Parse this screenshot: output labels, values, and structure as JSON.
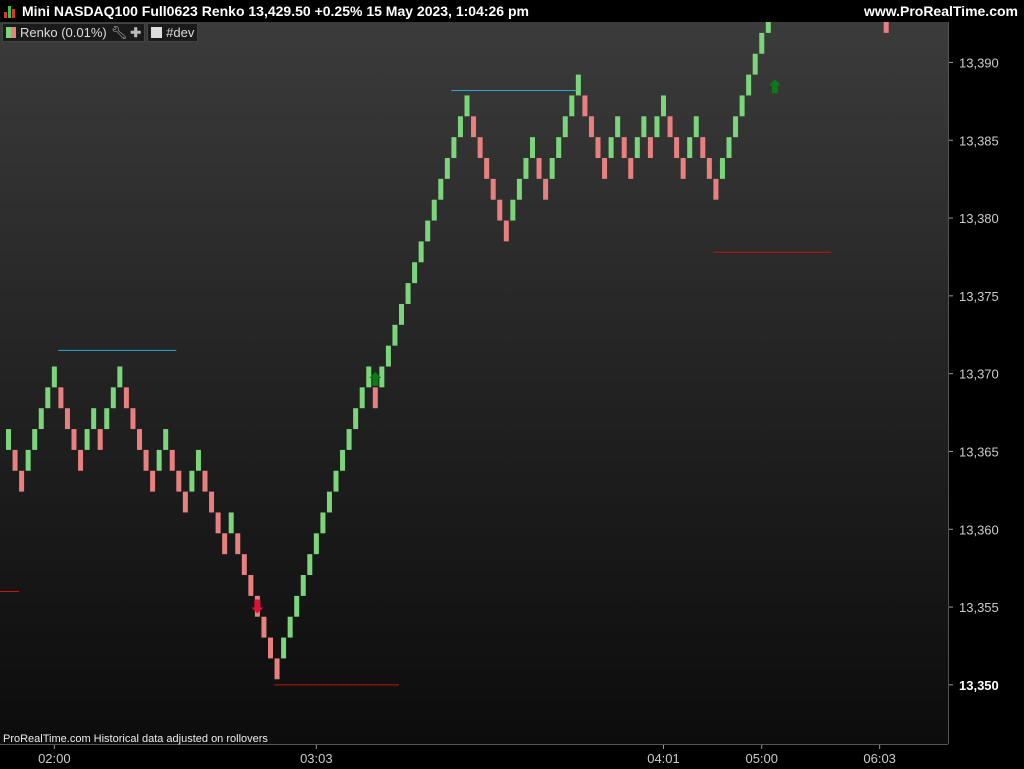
{
  "header": {
    "title": "Mini NASDAQ100 Full0623 Renko 13,429.50 +0.25% 15 May 2023, 1:04:26 pm",
    "site": "www.ProRealTime.com"
  },
  "legend": {
    "indicator_label": "Renko (0.01%)",
    "wrench_icon": "wrench-icon",
    "plus_icon": "plus-icon",
    "dev_label": "#dev",
    "up_color": "#7bd67b",
    "down_color": "#e88080"
  },
  "footer": {
    "note": "ProRealTime.com Historical data adjusted on rollovers"
  },
  "chart_data": {
    "type": "renko",
    "brick_size": 1.34,
    "ylim": [
      13346.2,
      13392.6
    ],
    "y_ticks": [
      13390,
      13385,
      13380,
      13375,
      13370,
      13365,
      13360,
      13355,
      13350
    ],
    "y_tick_labels": [
      "13,390",
      "13,385",
      "13,380",
      "13,375",
      "13,370",
      "13,365",
      "13,360",
      "13,355",
      "13,350"
    ],
    "highlighted_tick": "13,350",
    "x_ticks": [
      {
        "label": "02:00",
        "index": 7
      },
      {
        "label": "03:03",
        "index": 47
      },
      {
        "label": "04:01",
        "index": 100
      },
      {
        "label": "05:00",
        "index": 115
      },
      {
        "label": "06:03",
        "index": 133
      }
    ],
    "start_low": 13365.1,
    "bricks": [
      1,
      -1,
      -1,
      1,
      1,
      1,
      1,
      1,
      -1,
      -1,
      -1,
      -1,
      1,
      1,
      -1,
      1,
      1,
      1,
      -1,
      -1,
      -1,
      -1,
      -1,
      1,
      1,
      -1,
      -1,
      -1,
      1,
      1,
      -1,
      -1,
      -1,
      -1,
      1,
      -1,
      -1,
      -1,
      -1,
      -1,
      -1,
      -1,
      1,
      1,
      1,
      1,
      1,
      1,
      1,
      1,
      1,
      1,
      1,
      1,
      1,
      1,
      -1,
      1,
      1,
      1,
      1,
      1,
      1,
      1,
      1,
      1,
      1,
      1,
      1,
      1,
      1,
      -1,
      -1,
      -1,
      -1,
      -1,
      -1,
      1,
      1,
      1,
      1,
      -1,
      -1,
      1,
      1,
      1,
      1,
      1,
      -1,
      -1,
      -1,
      -1,
      1,
      1,
      -1,
      -1,
      1,
      1,
      -1,
      1,
      1,
      -1,
      -1,
      -1,
      1,
      1,
      -1,
      -1,
      -1,
      1,
      1,
      1,
      1,
      1,
      1,
      1,
      1,
      1,
      1,
      1,
      -1,
      -1,
      1,
      1,
      1,
      -1,
      -1,
      1,
      -1,
      -1,
      1,
      1,
      -1,
      -1,
      -1
    ],
    "signals": [
      {
        "type": "up",
        "at_index": 56,
        "price": 13369.6,
        "color": "#0a7a1a"
      },
      {
        "type": "up",
        "at_index": 117,
        "price": 13388.4,
        "color": "#0a7a1a"
      },
      {
        "type": "down",
        "at_index": 38,
        "price": 13355.1,
        "color": "#e0103a"
      }
    ],
    "levels": [
      {
        "price": 13371.5,
        "from_index": 8,
        "to_index": 26,
        "color": "#2aa8d8"
      },
      {
        "price": 13388.2,
        "from_index": 68,
        "to_index": 87,
        "color": "#2aa8d8"
      },
      {
        "price": 13377.8,
        "from_index": 108,
        "to_index": 126,
        "color": "#cc1111"
      },
      {
        "price": 13350.0,
        "from_index": 41,
        "to_index": 60,
        "color": "#cc1111"
      },
      {
        "price": 13356.0,
        "from_index": -1,
        "to_index": 2,
        "color": "#cc1111"
      }
    ]
  }
}
